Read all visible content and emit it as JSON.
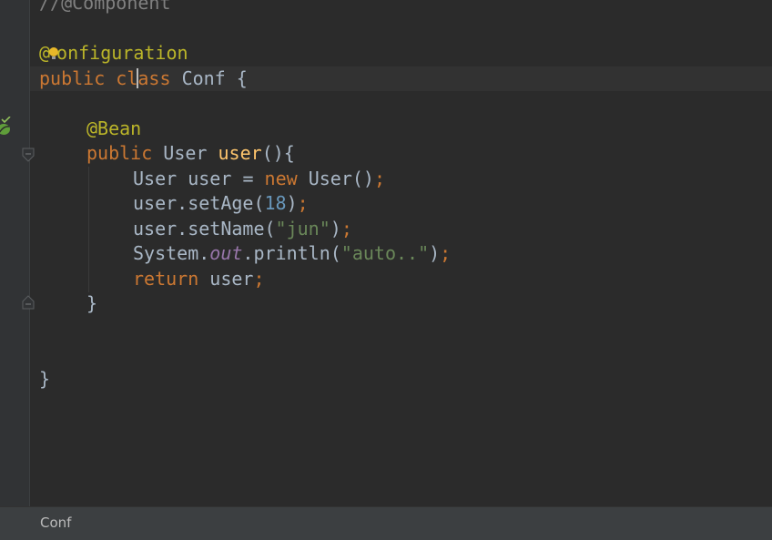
{
  "editor": {
    "lines": {
      "l1": {
        "comment": "//@Component"
      },
      "l2": {
        "at": "@",
        "rest": "onfiguration"
      },
      "l3": {
        "kw_public": "public",
        "kw_class_a": "cl",
        "kw_class_b": "ass",
        "name": "Conf",
        "brace": "{"
      },
      "l4": {
        "ann": "@Bean"
      },
      "l5": {
        "kw_public": "public",
        "type": "User",
        "method": "user",
        "parens": "(){"
      },
      "l6": {
        "type": "User",
        "var": "user",
        "eq": "=",
        "kw_new": "new",
        "ctor": "User()",
        "semi": ";"
      },
      "l7": {
        "call": "user.setAge(",
        "num": "18",
        "close": ")",
        "semi": ";"
      },
      "l8": {
        "call": "user.setName(",
        "str": "\"jun\"",
        "close": ")",
        "semi": ";"
      },
      "l9": {
        "sys": "System.",
        "out": "out",
        "call": ".println(",
        "str": "\"auto..\"",
        "close": ")",
        "semi": ";"
      },
      "l10": {
        "kw_return": "return",
        "var": "user",
        "semi": ";"
      },
      "l11": {
        "brace": "}"
      },
      "l12": {
        "brace": "}"
      }
    }
  },
  "colors": {
    "background": "#2b2b2b",
    "keyword": "#cc7832",
    "annotation": "#bbb529",
    "string": "#6a8759",
    "number": "#6897bb",
    "method": "#ffc66d",
    "static_field": "#9876aa",
    "comment": "#808080"
  },
  "icons": [
    "spring-bean-icon",
    "fold-start-icon",
    "fold-end-icon",
    "intention-bulb-icon"
  ],
  "statusbar": {
    "breadcrumb": "Conf"
  }
}
